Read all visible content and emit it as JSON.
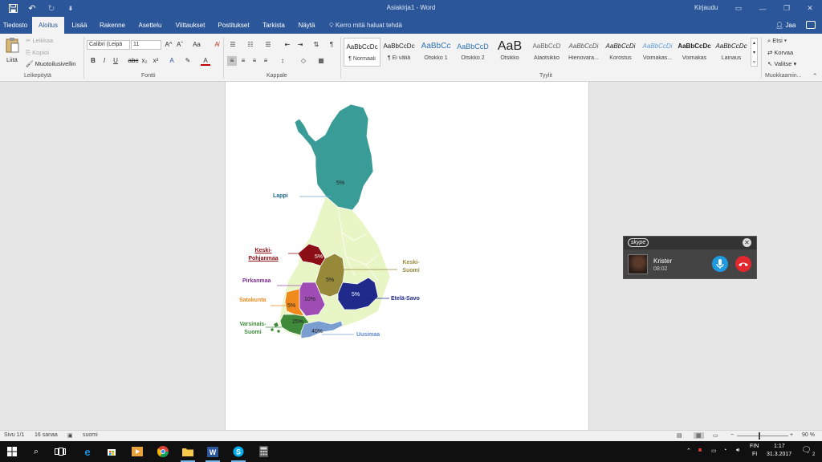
{
  "titlebar": {
    "document_title": "Asiakirja1  -  Word",
    "signin": "Kirjaudu",
    "qat": {
      "save_icon": "save-icon",
      "undo_icon": "undo-icon",
      "redo_icon": "redo-icon"
    }
  },
  "tabs": [
    {
      "label": "Tiedosto"
    },
    {
      "label": "Aloitus",
      "active": true
    },
    {
      "label": "Lisää"
    },
    {
      "label": "Rakenne"
    },
    {
      "label": "Asettelu"
    },
    {
      "label": "Viittaukset"
    },
    {
      "label": "Postitukset"
    },
    {
      "label": "Tarkista"
    },
    {
      "label": "Näytä"
    }
  ],
  "tellme": "Kerro mitä haluat tehdä",
  "share": "Jaa",
  "ribbon": {
    "clipboard": {
      "paste": "Liitä",
      "cut": "Leikkaa",
      "copy": "Kopioi",
      "format_painter": "Muotoilusivellin",
      "group": "Leikepöytä"
    },
    "font": {
      "family": "Calibri (Leipä",
      "size": "11",
      "group": "Fontti",
      "case_btn": "Aa",
      "bold": "B",
      "italic": "I",
      "underline": "U",
      "strike": "abc",
      "sub": "x₂",
      "sup": "x²",
      "grow": "A^",
      "shrink": "Aˇ",
      "effects": "A",
      "color": "A"
    },
    "paragraph": {
      "group": "Kappale",
      "pilcrow": "¶"
    },
    "styles": {
      "group": "Tyylit",
      "items": [
        {
          "preview": "AaBbCcDc",
          "name": "¶ Normaali"
        },
        {
          "preview": "AaBbCcDc",
          "name": "¶ Ei väliä"
        },
        {
          "preview": "AaBbCc",
          "name": "Otsikko 1"
        },
        {
          "preview": "AaBbCcD",
          "name": "Otsikko 2"
        },
        {
          "preview": "AaB",
          "name": "Otsikko"
        },
        {
          "preview": "AaBbCcD",
          "name": "Alaotsikko"
        },
        {
          "preview": "AaBbCcDi",
          "name": "Hienovara..."
        },
        {
          "preview": "AaBbCcDi",
          "name": "Korostus"
        },
        {
          "preview": "AaBbCcDi",
          "name": "Voimakas..."
        },
        {
          "preview": "AaBbCcDc",
          "name": "Voimakas"
        },
        {
          "preview": "AaBbCcDc",
          "name": "Lainaus"
        }
      ]
    },
    "editing": {
      "group": "Muokkaamin...",
      "find": "Etsi",
      "replace": "Korvaa",
      "select": "Valitse"
    }
  },
  "map": {
    "regions": [
      {
        "label": "Lappi",
        "value": "5%",
        "color": "#3a9c97"
      },
      {
        "label": "Keski-Pohjanmaa",
        "value": "5%",
        "color": "#8b0f14"
      },
      {
        "label": "Keski-Suomi",
        "value": "5%",
        "color": "#968a3a"
      },
      {
        "label": "Pirkanmaa",
        "value": "10%",
        "color": "#a04cb5"
      },
      {
        "label": "Etelä-Savo",
        "value": "5%",
        "color": "#1f2a8a"
      },
      {
        "label": "Satakunta",
        "value": "5%",
        "color": "#f08a1c"
      },
      {
        "label": "Varsinais-Suomi",
        "value": "25%",
        "color": "#3e8a3a"
      },
      {
        "label": "Uusimaa",
        "value": "40%",
        "color": "#7b9ed1"
      }
    ],
    "base_color": "#e8f5c4"
  },
  "skype": {
    "logo": "skype",
    "caller": "Krister",
    "duration": "08:02"
  },
  "statusbar": {
    "page": "Sivu 1/1",
    "words": "16 sanaa",
    "language": "suomi",
    "zoom": "90 %"
  },
  "taskbar": {
    "lang": "FIN",
    "lang2": "FI",
    "time": "1:17",
    "date": "31.3.2017",
    "notifications": "2"
  }
}
